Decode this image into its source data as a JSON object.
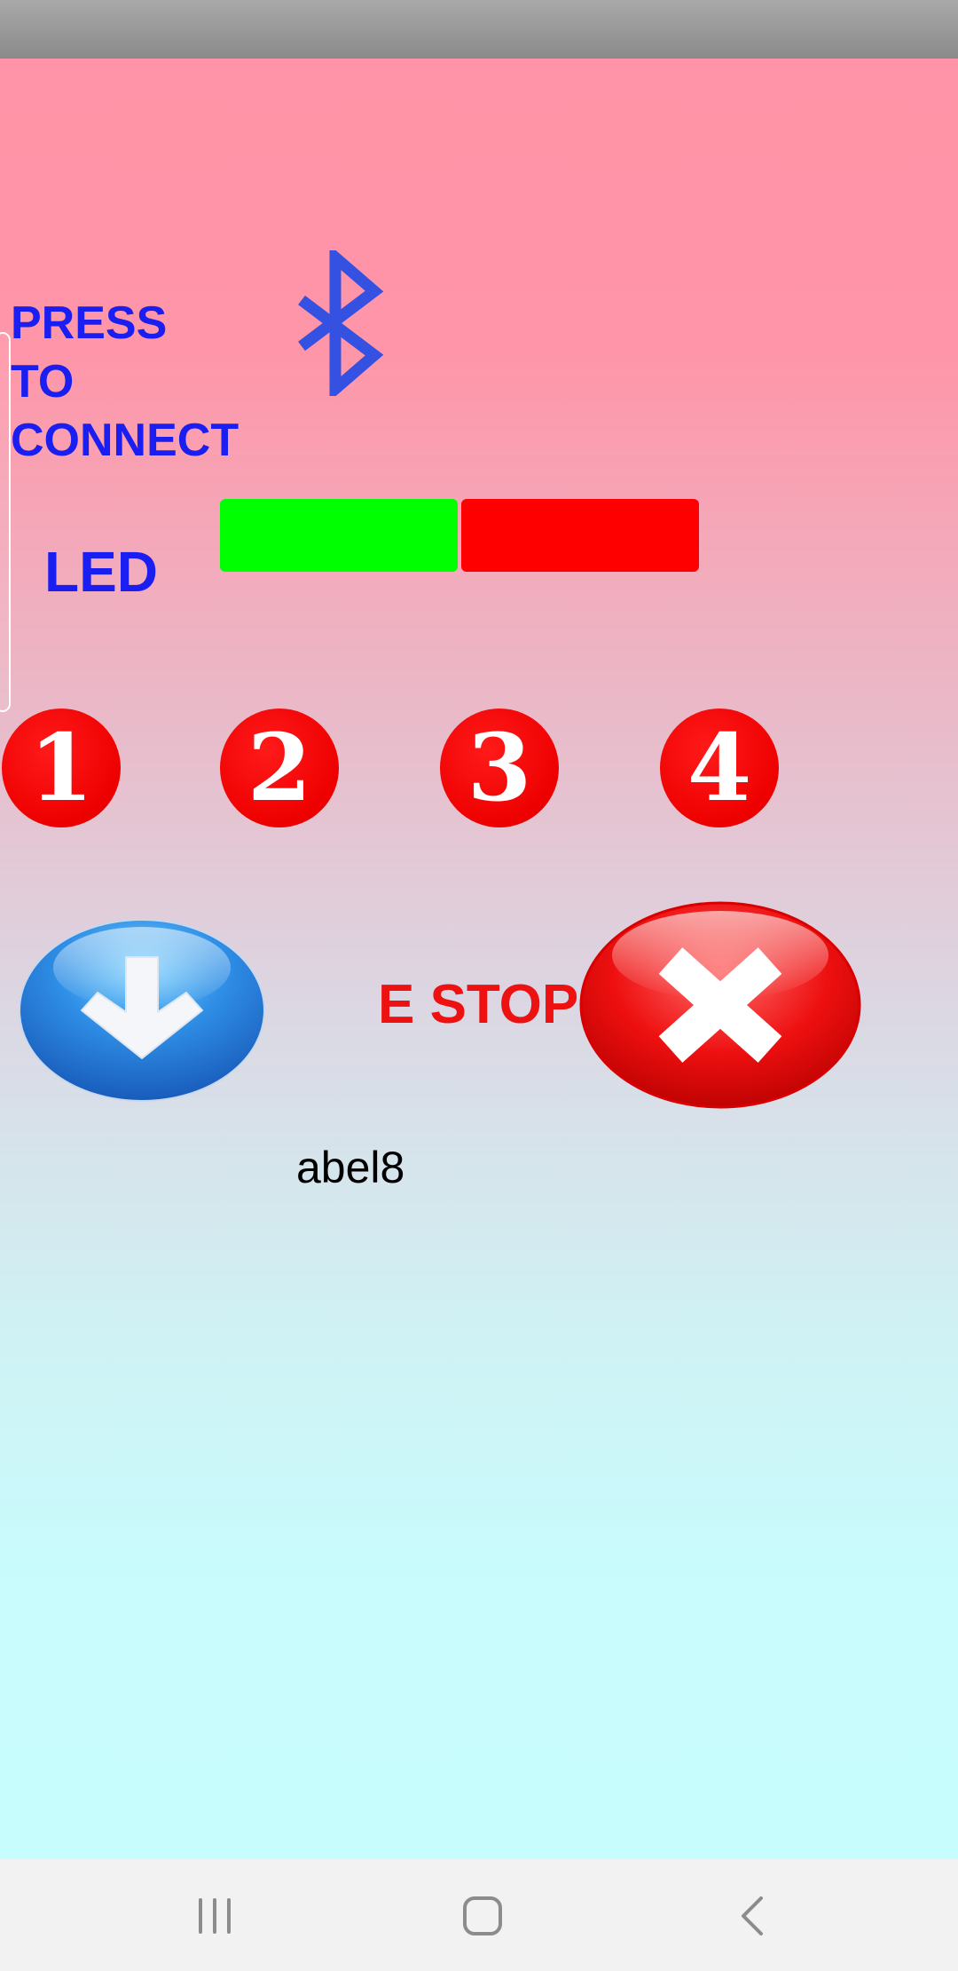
{
  "connect": {
    "label": "PRESS TO\nCONNECT",
    "icon": "bluetooth-icon",
    "icon_color": "#3451e2"
  },
  "led": {
    "label": "LED",
    "on_color": "#00ff00",
    "off_color": "#ff0000"
  },
  "number_buttons": [
    "1",
    "2",
    "3",
    "4"
  ],
  "down_button": {
    "icon": "down-arrow-icon"
  },
  "estop": {
    "label": "E STOP",
    "icon": "close-icon",
    "color": "#ee1111"
  },
  "caption": "abel8",
  "navigation": {
    "recent_icon": "recent-apps-icon",
    "home_icon": "home-icon",
    "back_icon": "back-icon"
  },
  "colors": {
    "label_blue": "#1a1ef0",
    "background_top": "#ff93a7",
    "background_bottom": "#c8fdfd"
  }
}
